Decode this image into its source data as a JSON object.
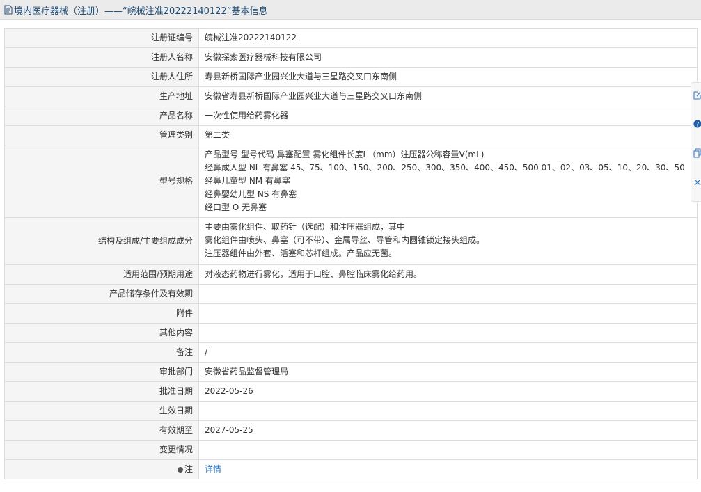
{
  "header": {
    "title": "境内医疗器械（注册）——“皖械注准20222140122”基本信息",
    "icon": "document-icon"
  },
  "rows": [
    {
      "key": "reg_no",
      "label": "注册证编号",
      "value": "皖械注准20222140122"
    },
    {
      "key": "registrant",
      "label": "注册人名称",
      "value": "安徽探索医疗器械科技有限公司"
    },
    {
      "key": "registrant_addr",
      "label": "注册人住所",
      "value": "寿县新桥国际产业园兴业大道与三星路交叉口东南侧"
    },
    {
      "key": "production_addr",
      "label": "生产地址",
      "value": "安徽省寿县新桥国际产业园兴业大道与三星路交叉口东南侧"
    },
    {
      "key": "product_name",
      "label": "产品名称",
      "value": "一次性使用给药雾化器"
    },
    {
      "key": "category",
      "label": "管理类别",
      "value": "第二类"
    },
    {
      "key": "spec",
      "label": "型号规格",
      "lines": [
        "产品型号 型号代码 鼻塞配置 雾化组件长度L（mm）注压器公称容量V(mL)",
        "经鼻成人型 NL 有鼻塞 45、75、100、150、200、250、300、350、400、450、500 01、02、03、05、10、20、30、50",
        "经鼻儿童型 NM 有鼻塞",
        "经鼻婴幼儿型 NS 有鼻塞",
        "经口型 O 无鼻塞"
      ]
    },
    {
      "key": "structure",
      "label": "结构及组成/主要组成成分",
      "lines": [
        "主要由雾化组件、取药针（选配）和注压器组成，其中",
        "雾化组件由喷头、鼻塞（可不带）、金属导丝、导管和内圆锥锁定接头组成。",
        "注压器组件由外套、活塞和芯杆组成。产品应无菌。"
      ]
    },
    {
      "key": "scope",
      "label": "适用范围/预期用途",
      "value": "对液态药物进行雾化，适用于口腔、鼻腔临床雾化给药用。"
    },
    {
      "key": "storage",
      "label": "产品储存条件及有效期",
      "value": ""
    },
    {
      "key": "attachment",
      "label": "附件",
      "value": ""
    },
    {
      "key": "other",
      "label": "其他内容",
      "value": ""
    },
    {
      "key": "remark",
      "label": "备注",
      "value": "/"
    },
    {
      "key": "approval_dept",
      "label": "审批部门",
      "value": "安徽省药品监督管理局"
    },
    {
      "key": "approval_date",
      "label": "批准日期",
      "value": "2022-05-26"
    },
    {
      "key": "effective_date",
      "label": "生效日期",
      "value": ""
    },
    {
      "key": "expiry_date",
      "label": "有效期至",
      "value": "2027-05-25"
    },
    {
      "key": "change_info",
      "label": "变更情况",
      "value": ""
    },
    {
      "key": "note",
      "label": "注",
      "value": "详情",
      "label_icon": "pin-icon"
    }
  ],
  "side_tools": [
    "edit-icon",
    "help-icon",
    "copy-icon",
    "close-icon"
  ],
  "colors": {
    "title": "#1f4e79",
    "link": "#2a73c5",
    "label_bg": "#f5f5f5",
    "border": "#dcdcdc"
  }
}
